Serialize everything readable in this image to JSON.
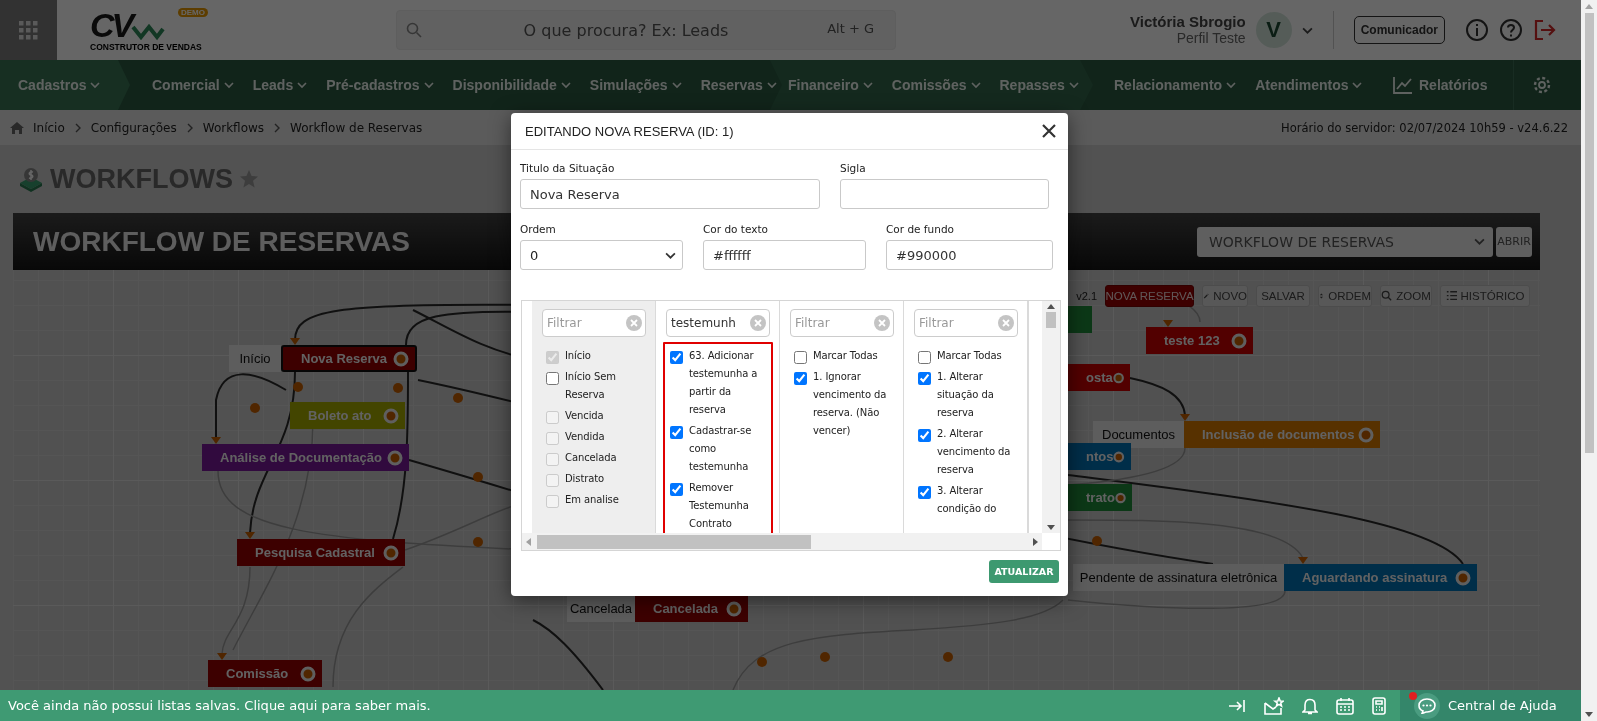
{
  "header": {
    "logo": {
      "letters": "CV",
      "badge": "DEMO",
      "tagline": "CONSTRUTOR DE VENDAS"
    },
    "search": {
      "placeholder": "O que procura? Ex: Leads",
      "shortcut": "Alt + G"
    },
    "user": {
      "name": "Victória Sbrogio",
      "profile": "Perfil Teste",
      "avatar": "V"
    },
    "communicator_button": "Comunicador"
  },
  "nav": {
    "groups": [
      {
        "items": [
          "Cadastros"
        ]
      },
      {
        "items": [
          "Comercial",
          "Leads",
          "Pré-cadastros",
          "Disponibilidade",
          "Simulações",
          "Reservas"
        ]
      },
      {
        "items": [
          "Financeiro",
          "Comissões",
          "Repasses"
        ]
      },
      {
        "items": [
          "Relacionamento",
          "Atendimentos"
        ]
      }
    ],
    "reports": "Relatórios"
  },
  "breadcrumb": [
    "Início",
    "Configurações",
    "Workflows",
    "Workflow de Reservas"
  ],
  "server_info": "Horário do servidor: 02/07/2024 10h59 - v24.6.22",
  "page_title": "WORKFLOWS",
  "workflow": {
    "title": "WORKFLOW DE RESERVAS",
    "selector": "WORKFLOW DE RESERVAS",
    "open_button": "ABRIR",
    "version": "v2.1",
    "toolbar": [
      {
        "label": "NOVA RESERVA",
        "kind": "primary"
      },
      {
        "label": "NOVO",
        "kind": "edit"
      },
      {
        "label": "SALVAR",
        "kind": "plain"
      },
      {
        "label": "ORDEM",
        "kind": "sort"
      },
      {
        "label": "ZOOM",
        "kind": "search"
      },
      {
        "label": "HISTÓRICO",
        "kind": "list"
      }
    ],
    "nodes": [
      {
        "label": "Nova Reserva",
        "tag": "Início",
        "color": "#3d0000",
        "selected": true
      },
      {
        "label": "Boleto ato",
        "color": "#434500",
        "selected": false
      },
      {
        "label": "Análise de Documentação",
        "color": "#310a3e",
        "selected": false
      },
      {
        "label": "Pesquisa Cadastral",
        "color": "#3d0000",
        "selected": false
      },
      {
        "label": "Comissão",
        "color": "#3d0000",
        "selected": false
      },
      {
        "label": "teste 123",
        "color": "#520000",
        "selected": false
      },
      {
        "label": "osta",
        "color": "#520000",
        "selected": false
      },
      {
        "label": "Inclusão de documentos",
        "tag": "Documentos",
        "color": "#573100",
        "selected": false
      },
      {
        "label": "ntos",
        "color": "#002e49",
        "selected": false
      },
      {
        "label": "trato",
        "color": "#0c3817",
        "selected": false
      },
      {
        "color": "#0c3817",
        "selected": false
      },
      {
        "label": "Aguardando assinatura",
        "tag": "Pendente de assinatura eletrônica",
        "color": "#002e49",
        "selected": false
      },
      {
        "label": "Cancelada",
        "tag": "Cancelada",
        "color": "#3d0000",
        "selected": false
      }
    ]
  },
  "modal": {
    "title": "EDITANDO NOVA RESERVA (ID: 1)",
    "fields": [
      {
        "label": "Titulo da Situação",
        "value": "Nova Reserva",
        "kind": "text"
      },
      {
        "label": "Sigla",
        "kind": "text"
      },
      {
        "label": "Ordem",
        "value": "0",
        "kind": "select"
      },
      {
        "label": "Cor do texto",
        "value": "#ffffff",
        "kind": "text"
      },
      {
        "label": "Cor de fundo",
        "value": "#990000",
        "kind": "text"
      }
    ],
    "columns": [
      {
        "filter": {
          "placeholder": "Filtrar"
        },
        "highlighted": false,
        "items": [
          {
            "label": "Início",
            "checked": true,
            "disabled": true
          },
          {
            "label": "Início Sem Reserva",
            "checked": false,
            "disabled": false
          },
          {
            "label": "Vencida",
            "checked": false,
            "disabled": true
          },
          {
            "label": "Vendida",
            "checked": false,
            "disabled": true
          },
          {
            "label": "Cancelada",
            "checked": false,
            "disabled": true
          },
          {
            "label": "Distrato",
            "checked": false,
            "disabled": true
          },
          {
            "label": "Em analise",
            "checked": false,
            "disabled": true
          }
        ]
      },
      {
        "filter": {
          "value": "testemunh"
        },
        "highlighted": true,
        "items": [
          {
            "label": "63. Adicionar testemunha a partir da reserva",
            "checked": true,
            "disabled": false
          },
          {
            "label": "Cadastrar-se como testemunha",
            "checked": true,
            "disabled": false
          },
          {
            "label": "Remover Testemunha Contrato",
            "checked": true,
            "disabled": false
          }
        ]
      },
      {
        "filter": {
          "placeholder": "Filtrar"
        },
        "highlighted": false,
        "items": [
          {
            "label": "Marcar Todas",
            "checked": false,
            "disabled": false
          },
          {
            "label": "1. Ignorar vencimento da reserva. (Não vencer)",
            "checked": true,
            "disabled": false
          }
        ]
      },
      {
        "filter": {
          "placeholder": "Filtrar"
        },
        "highlighted": false,
        "items": [
          {
            "label": "Marcar Todas",
            "checked": false,
            "disabled": false
          },
          {
            "label": "1. Alterar situação da reserva",
            "checked": true,
            "disabled": false
          },
          {
            "label": "2. Alterar vencimento da reserva",
            "checked": true,
            "disabled": false
          },
          {
            "label": "3. Alterar condição do",
            "checked": true,
            "disabled": false
          }
        ]
      }
    ],
    "button": "ATUALIZAR"
  },
  "status_bar": {
    "message": "Você ainda não possui listas salvas. Clique aqui para saber mais.",
    "help": "Central de Ajuda",
    "help_notification": true
  }
}
